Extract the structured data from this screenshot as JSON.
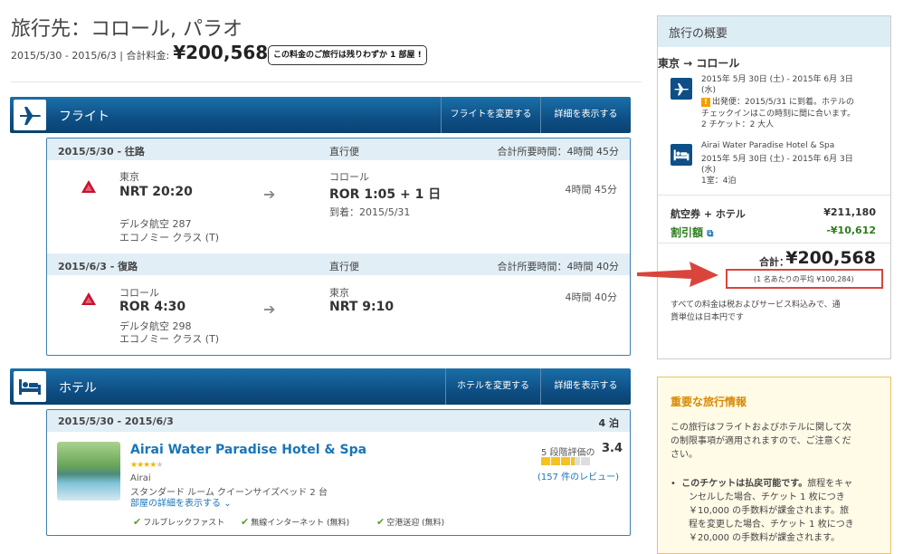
{
  "header": {
    "title": "旅行先：コロール, パラオ",
    "dates_label": "2015/5/30 - 2015/6/3 | 合計料金:",
    "total_price": "¥200,568",
    "scarcity_note": "この料金のご旅行は残りわずか 1 部屋 !"
  },
  "flight_section": {
    "title": "フライト",
    "change_button": "フライトを変更する",
    "details_button": "詳細を表示する",
    "legs": [
      {
        "date_label": "2015/5/30 - 往路",
        "type": "直行便",
        "total_time": "合計所要時間：4時間 45分",
        "from_city": "東京",
        "from_time": "NRT 20:20",
        "to_city": "コロール",
        "to_time": "ROR 1:05 + 1 日",
        "arrival": "到着：2015/5/31",
        "duration": "4時間 45分",
        "airline": "デルタ航空 287",
        "cabin": "エコノミー クラス (T)"
      },
      {
        "date_label": "2015/6/3 - 復路",
        "type": "直行便",
        "total_time": "合計所要時間：4時間 40分",
        "from_city": "コロール",
        "from_time": "ROR 4:30",
        "to_city": "東京",
        "to_time": "NRT 9:10",
        "duration": "4時間 40分",
        "airline": "デルタ航空 298",
        "cabin": "エコノミー クラス (T)"
      }
    ]
  },
  "hotel_section": {
    "title": "ホテル",
    "change_button": "ホテルを変更する",
    "details_button": "詳細を表示する",
    "dates": "2015/5/30 - 2015/6/3",
    "nights": "4 泊",
    "name": "Airai Water Paradise Hotel & Spa",
    "star_rating": 3.5,
    "location": "Airai",
    "room": "スタンダード ルーム クイーンサイズベッド 2 台",
    "room_details_link": "部屋の詳細を表示する",
    "rating_label": "5 段階評価の",
    "rating_value": "3.4",
    "reviews_link": "(157 件のレビュー)",
    "amenities": [
      "フルブレックファスト",
      "無線インターネット (無料)",
      "空港送迎 (無料)"
    ]
  },
  "summary": {
    "title": "旅行の概要",
    "route": "東京 → コロール",
    "flight_dates_1": "2015年 5月 30日 (土) - 2015年 6月 3日",
    "flight_dates_2": "(水)",
    "flight_warning_1": "出発便：2015/5/31 に到着。ホテルの",
    "flight_warning_2": "チェックインはこの時刻に間に合います。",
    "flight_pax": "2 チケット：2 大人",
    "hotel_name": "Airai Water Paradise Hotel & Spa",
    "hotel_dates_1": "2015年 5月 30日 (土) - 2015年 6月 3日",
    "hotel_dates_2": "(水)",
    "hotel_rooms": "1室：4泊",
    "package_label": "航空券 + ホテル",
    "package_price": "¥211,180",
    "discount_label": "割引額",
    "discount_price": "-¥10,612",
    "total_label": "合計：",
    "total_price": "¥200,568",
    "per_person": "(1 名あたりの平均 ¥100,284)",
    "tax_note_1": "すべての料金は税およびサービス料込みで、通",
    "tax_note_2": "貨単位は日本円です"
  },
  "info": {
    "title": "重要な旅行情報",
    "intro_1": "この旅行はフライトおよびホテルに関して次",
    "intro_2": "の制限事項が適用されますので、ご注意くだ",
    "intro_3": "さい。",
    "bullet_bold": "このチケットは払戻可能です。",
    "bullet_1": "旅程をキャ",
    "bullet_2": "ンセルした場合、チケット 1 枚につき",
    "bullet_3": "￥10,000 の手数料が課金されます。旅",
    "bullet_4": "程を変更した場合、チケット 1 枚につき",
    "bullet_5": "￥20,000 の手数料が課金されます。"
  },
  "colors": {
    "bar_blue": "#0e4f86",
    "link_blue": "#1a75b7",
    "discount_green": "#2e7d1e",
    "highlight_red": "#d9453b",
    "info_title": "#d98a00"
  }
}
